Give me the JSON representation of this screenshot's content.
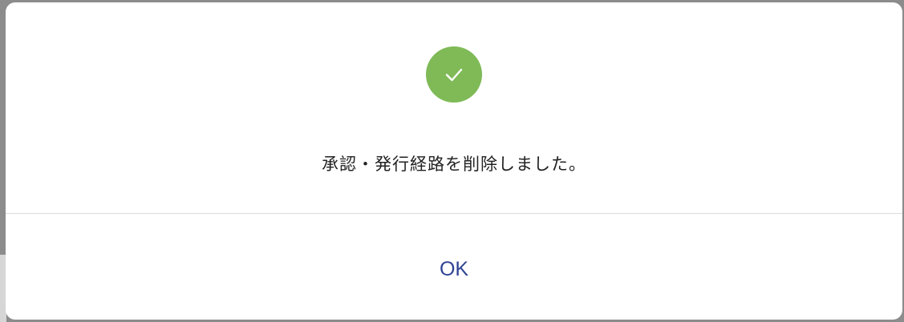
{
  "dialog": {
    "message": "承認・発行経路を削除しました。",
    "icon": "check-circle-icon",
    "ok_label": "OK"
  },
  "colors": {
    "success": "#7fba57",
    "button_text": "#2f4393"
  }
}
